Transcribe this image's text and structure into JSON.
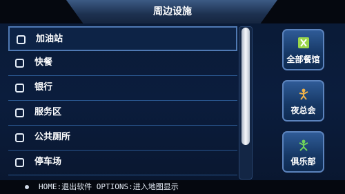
{
  "title": "周边设施",
  "list": {
    "items": [
      {
        "label": "加油站",
        "checked": false,
        "selected": true
      },
      {
        "label": "快餐",
        "checked": false,
        "selected": false
      },
      {
        "label": "银行",
        "checked": false,
        "selected": false
      },
      {
        "label": "服务区",
        "checked": false,
        "selected": false
      },
      {
        "label": "公共厕所",
        "checked": false,
        "selected": false
      },
      {
        "label": "停车场",
        "checked": false,
        "selected": false
      }
    ]
  },
  "categories": [
    {
      "label": "全部餐馆",
      "icon": "all-restaurants-icon",
      "color": "#9ad64a"
    },
    {
      "label": "夜总会",
      "icon": "nightclub-icon",
      "color": "#f0b24a"
    },
    {
      "label": "俱乐部",
      "icon": "club-icon",
      "color": "#6fd35b"
    }
  ],
  "status": {
    "text": "HOME:退出软件  OPTIONS:进入地图显示"
  }
}
